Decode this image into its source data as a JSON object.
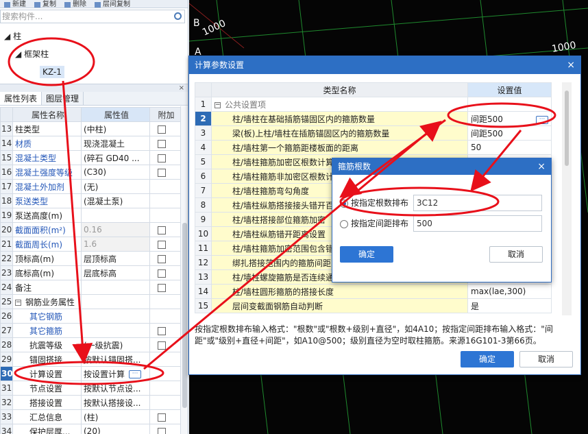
{
  "toolbar": {
    "items": [
      "新建",
      "复制",
      "删除",
      "层间复制"
    ]
  },
  "search": {
    "placeholder": "搜索构件..."
  },
  "tree": {
    "root": "柱",
    "group": "框架柱",
    "item": "KZ-1"
  },
  "panel": {
    "tabs": [
      "属性列表",
      "图层管理"
    ],
    "headers": [
      "属性名称",
      "属性值",
      "附加"
    ]
  },
  "props": [
    {
      "num": "13",
      "name": "柱类型",
      "value": "(中柱)",
      "blue": false,
      "check": true
    },
    {
      "num": "14",
      "name": "材质",
      "value": "现浇混凝土",
      "blue": true,
      "check": true
    },
    {
      "num": "15",
      "name": "混凝土类型",
      "value": "(碎石 GD40 ...",
      "blue": true,
      "check": true
    },
    {
      "num": "16",
      "name": "混凝土强度等级",
      "value": "(C30)",
      "blue": true,
      "check": true
    },
    {
      "num": "17",
      "name": "混凝土外加剂",
      "value": "(无)",
      "blue": true,
      "check": false
    },
    {
      "num": "18",
      "name": "泵送类型",
      "value": "(混凝土泵)",
      "blue": true,
      "check": false
    },
    {
      "num": "19",
      "name": "泵送高度(m)",
      "value": "",
      "blue": false,
      "check": false
    },
    {
      "num": "20",
      "name": "截面面积(m²)",
      "value": "0.16",
      "blue": true,
      "check": true,
      "gray": true
    },
    {
      "num": "21",
      "name": "截面周长(m)",
      "value": "1.6",
      "blue": true,
      "check": true,
      "gray": true
    },
    {
      "num": "22",
      "name": "顶标高(m)",
      "value": "层顶标高",
      "blue": false,
      "check": true
    },
    {
      "num": "23",
      "name": "底标高(m)",
      "value": "层底标高",
      "blue": false,
      "check": true
    },
    {
      "num": "24",
      "name": "备注",
      "value": "",
      "blue": false,
      "check": true
    },
    {
      "num": "25",
      "name": "钢筋业务属性",
      "value": "",
      "blue": false,
      "check": false,
      "group": true
    },
    {
      "num": "26",
      "name": "其它钢筋",
      "value": "",
      "blue": true,
      "check": false,
      "indent": true
    },
    {
      "num": "27",
      "name": "其它箍筋",
      "value": "",
      "blue": true,
      "check": true,
      "indent": true
    },
    {
      "num": "28",
      "name": "抗震等级",
      "value": "(一级抗震)",
      "blue": false,
      "check": true,
      "indent": true
    },
    {
      "num": "29",
      "name": "锚固搭接",
      "value": "按默认锚固搭...",
      "blue": false,
      "check": false,
      "indent": true
    },
    {
      "num": "30",
      "name": "计算设置",
      "value": "按设置计算",
      "blue": false,
      "check": false,
      "indent": true,
      "sel": true,
      "btn": true
    },
    {
      "num": "31",
      "name": "节点设置",
      "value": "按默认节点设...",
      "blue": false,
      "check": false,
      "indent": true
    },
    {
      "num": "32",
      "name": "搭接设置",
      "value": "按默认搭接设...",
      "blue": false,
      "check": false,
      "indent": true
    },
    {
      "num": "33",
      "name": "汇总信息",
      "value": "(柱)",
      "blue": false,
      "check": true,
      "indent": true
    },
    {
      "num": "34",
      "name": "保护层厚...",
      "value": "(20)",
      "blue": false,
      "check": true,
      "indent": true
    }
  ],
  "cad": {
    "labels": [
      "B",
      "1000",
      "1000",
      "A"
    ]
  },
  "dialog": {
    "title": "计算参数设置",
    "close": "×",
    "headers": [
      "类型名称",
      "设置值"
    ],
    "rows": [
      {
        "num": "1",
        "name": "公共设置项",
        "value": "",
        "group": true
      },
      {
        "num": "2",
        "name": "柱/墙柱在基础插筋锚固区内的箍筋数量",
        "value": "间距500",
        "sel": true,
        "btn": true
      },
      {
        "num": "3",
        "name": "梁(板)上柱/墙柱在插筋锚固区内的箍筋数量",
        "value": "间距500"
      },
      {
        "num": "4",
        "name": "柱/墙柱第一个箍筋距楼板面的距离",
        "value": "50"
      },
      {
        "num": "5",
        "name": "柱/墙柱箍筋加密区根数计算方式",
        "value": ""
      },
      {
        "num": "6",
        "name": "柱/墙柱箍筋非加密区根数计算方式",
        "value": ""
      },
      {
        "num": "7",
        "name": "柱/墙柱箍筋弯勾角度",
        "value": ""
      },
      {
        "num": "8",
        "name": "柱/墙柱纵筋搭接接头错开百分率",
        "value": ""
      },
      {
        "num": "9",
        "name": "柱/墙柱搭接部位箍筋加密",
        "value": ""
      },
      {
        "num": "10",
        "name": "柱/墙柱纵筋错开距离设置",
        "value": ""
      },
      {
        "num": "11",
        "name": "柱/墙柱箍筋加密范围包含错开距离",
        "value": ""
      },
      {
        "num": "12",
        "name": "绑扎搭接范围内的箍筋间距",
        "value": ""
      },
      {
        "num": "13",
        "name": "柱/墙柱螺旋箍筋是否连续通过",
        "value": ""
      },
      {
        "num": "14",
        "name": "柱/墙柱圆形箍筋的搭接长度",
        "value": "max(lae,300)"
      },
      {
        "num": "15",
        "name": "层间变截面钢筋自动判断",
        "value": "是"
      }
    ],
    "hint": "按指定根数排布输入格式：\"根数\"或\"根数+级别+直径\"，如4A10；按指定间距排布输入格式：\"间距\"或\"级别+直径+间距\"，如A10@500；级别直径为空时取柱箍筋。来源16G101-3第66页。",
    "ok": "确定",
    "cancel": "取消"
  },
  "subdialog": {
    "title": "箍筋根数",
    "close": "×",
    "opt1": "按指定根数排布",
    "opt1_value": "3C12",
    "opt2": "按指定间距排布",
    "opt2_value": "500",
    "ok": "确定",
    "cancel": "取消"
  },
  "colors": {
    "annotation": "#e8101a",
    "accent": "#2d6fc4",
    "cad_grid": "#1f8a2e"
  }
}
